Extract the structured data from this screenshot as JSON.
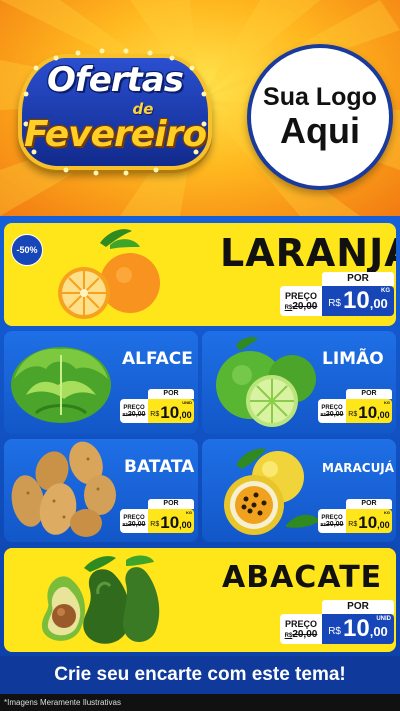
{
  "header": {
    "badge_line1": "Ofertas",
    "badge_line2": "de",
    "badge_line3": "Fevereiro",
    "logo_line1": "Sua Logo",
    "logo_line2": "Aqui"
  },
  "products": [
    {
      "name": "LARANJA",
      "discount": "-50%",
      "por_label": "POR",
      "preco_label": "PREÇO",
      "old_currency": "R$",
      "old_price": "20,00",
      "currency": "R$",
      "price_int": "10",
      "price_dec": ",00",
      "unit": "KG",
      "image": "orange-icon"
    },
    {
      "name": "ALFACE",
      "por_label": "POR",
      "preco_label": "PREÇO",
      "old_currency": "R$",
      "old_price": "20,00",
      "currency": "R$",
      "price_int": "10",
      "price_dec": ",00",
      "unit": "UNID",
      "image": "lettuce-icon"
    },
    {
      "name": "LIMÃO",
      "por_label": "POR",
      "preco_label": "PREÇO",
      "old_currency": "R$",
      "old_price": "20,00",
      "currency": "R$",
      "price_int": "10",
      "price_dec": ",00",
      "unit": "KG",
      "image": "lime-icon"
    },
    {
      "name": "BATATA",
      "por_label": "POR",
      "preco_label": "PREÇO",
      "old_currency": "R$",
      "old_price": "20,00",
      "currency": "R$",
      "price_int": "10",
      "price_dec": ",00",
      "unit": "KG",
      "image": "potato-icon"
    },
    {
      "name": "MARACUJÁ",
      "por_label": "POR",
      "preco_label": "PREÇO",
      "old_currency": "R$",
      "old_price": "20,00",
      "currency": "R$",
      "price_int": "10",
      "price_dec": ",00",
      "unit": "KG",
      "image": "passion-fruit-icon"
    },
    {
      "name": "ABACATE",
      "por_label": "POR",
      "preco_label": "PREÇO",
      "old_currency": "R$",
      "old_price": "20,00",
      "currency": "R$",
      "price_int": "10",
      "price_dec": ",00",
      "unit": "UNID",
      "image": "avocado-icon"
    }
  ],
  "footer": {
    "cta": "Crie seu encarte com este tema!",
    "disclaimer": "*Imagens Meramente Ilustrativas"
  },
  "colors": {
    "panel_blue": "#1560d8",
    "card_yellow": "#ffe61a",
    "price_blue": "#1746b8",
    "header_orange": "#f27a12"
  }
}
